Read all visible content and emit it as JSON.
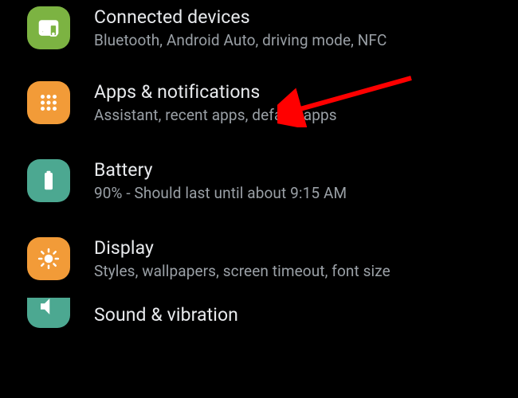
{
  "colors": {
    "green": "#7cb342",
    "orange": "#f29b38",
    "teal": "#4ca891"
  },
  "rows": {
    "connected": {
      "title": "Connected devices",
      "sub": "Bluetooth, Android Auto, driving mode, NFC"
    },
    "apps": {
      "title": "Apps & notifications",
      "sub": "Assistant, recent apps, default apps"
    },
    "battery": {
      "title": "Battery",
      "sub": "90% - Should last until about 9:15 AM"
    },
    "display": {
      "title": "Display",
      "sub": "Styles, wallpapers, screen timeout, font size"
    },
    "sound": {
      "title": "Sound & vibration",
      "sub": ""
    }
  },
  "annotation": {
    "target": "apps-notifications-row"
  }
}
